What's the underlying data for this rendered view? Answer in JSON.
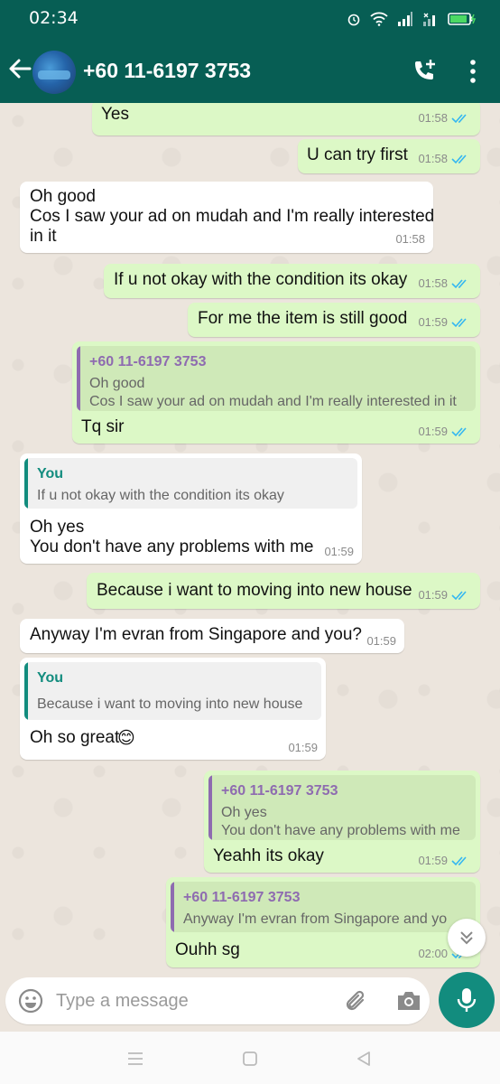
{
  "status_bar": {
    "time": "02:34"
  },
  "header": {
    "contact_name": "+60 11-6197 3753"
  },
  "messages": [
    {
      "id": "m1",
      "direction": "out",
      "text": "Yes",
      "time": "01:58",
      "status": "read"
    },
    {
      "id": "m2",
      "direction": "out",
      "text": "U can try first",
      "time": "01:58",
      "status": "read"
    },
    {
      "id": "m3",
      "direction": "in",
      "lines": [
        "Oh good",
        "Cos I saw your ad on mudah and I'm really interested",
        "in it"
      ],
      "time": "01:58"
    },
    {
      "id": "m4",
      "direction": "out",
      "text": "If u not okay with the condition its okay",
      "time": "01:58",
      "status": "read"
    },
    {
      "id": "m5",
      "direction": "out",
      "text": "For me the item is still good",
      "time": "01:59",
      "status": "read"
    },
    {
      "id": "m6",
      "direction": "out",
      "reply_to": {
        "name": "+60 11-6197 3753",
        "lines": [
          "Oh good",
          "Cos I saw your ad on mudah and I'm really interested in it"
        ]
      },
      "text": "Tq sir",
      "time": "01:59",
      "status": "read"
    },
    {
      "id": "m7",
      "direction": "in",
      "reply_to": {
        "name": "You",
        "lines": [
          "If u not okay with the condition its okay"
        ]
      },
      "lines": [
        "Oh yes",
        "You don't have any problems with me"
      ],
      "time": "01:59"
    },
    {
      "id": "m8",
      "direction": "out",
      "text": "Because i want to moving into new house",
      "time": "01:59",
      "status": "read"
    },
    {
      "id": "m9",
      "direction": "in",
      "text": "Anyway I'm evran from Singapore and you?",
      "time": "01:59"
    },
    {
      "id": "m10",
      "direction": "in",
      "reply_to": {
        "name": "You",
        "lines": [
          "Because i want to moving into new house"
        ]
      },
      "text": "Oh so great",
      "emoji": "😊",
      "time": "01:59"
    },
    {
      "id": "m11",
      "direction": "out",
      "reply_to": {
        "name": "+60 11-6197 3753",
        "lines": [
          "Oh yes",
          "You don't have any problems with me"
        ]
      },
      "text": "Yeahh its okay",
      "time": "01:59",
      "status": "read"
    },
    {
      "id": "m12",
      "direction": "out",
      "reply_to": {
        "name": "+60 11-6197 3753",
        "lines": [
          "Anyway I'm evran from Singapore and yo"
        ]
      },
      "text": "Ouhh sg",
      "time": "02:00",
      "status": "read"
    }
  ],
  "composer": {
    "placeholder": "Type a message"
  },
  "colors": {
    "header": "#075e54",
    "outgoing": "#dcf8c6",
    "incoming": "#ffffff",
    "tick_read": "#34b7f1",
    "quote_contact": "#8e6bb0",
    "quote_you": "#128c7e",
    "mic": "#128c7e"
  }
}
